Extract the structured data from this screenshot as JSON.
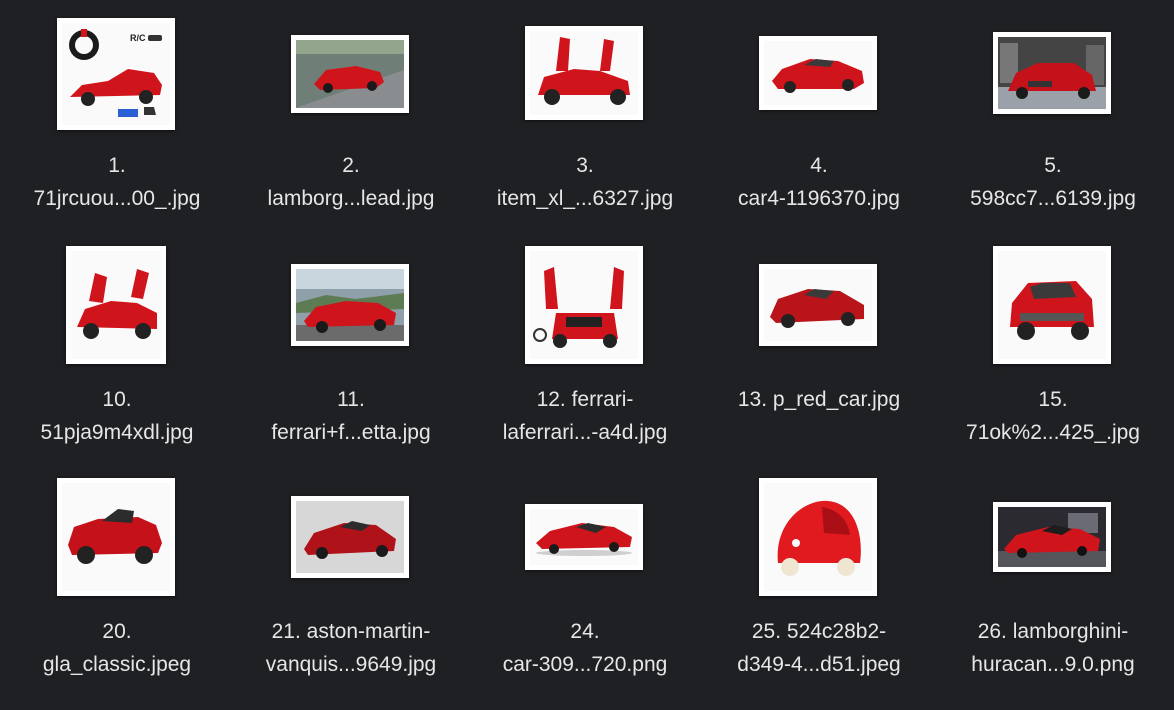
{
  "files": [
    {
      "line1": "1.",
      "line2": "71jrcuou...00_.jpg",
      "thumb": "rc-car-kit-thumbnail"
    },
    {
      "line1": "2.",
      "line2": "lamborg...lead.jpg",
      "thumb": "lamborghini-road-thumbnail"
    },
    {
      "line1": "3.",
      "line2": "item_xl_...6327.jpg",
      "thumb": "ride-on-car-doors-thumbnail"
    },
    {
      "line1": "4.",
      "line2": "car4-1196370.jpg",
      "thumb": "red-coupe-thumbnail"
    },
    {
      "line1": "5.",
      "line2": "598cc7...6139.jpg",
      "thumb": "maserati-showroom-thumbnail"
    },
    {
      "line1": "10.",
      "line2": "51pja9m4xdl.jpg",
      "thumb": "toy-supercar-doors-thumbnail"
    },
    {
      "line1": "11.",
      "line2": "ferrari+f...etta.jpg",
      "thumb": "ferrari-berlinetta-thumbnail"
    },
    {
      "line1": "12. ferrari-",
      "line2": "laferrari...-a4d.jpg",
      "thumb": "laferrari-toy-thumbnail"
    },
    {
      "line1": "13. p_red_car.jpg",
      "line2": "",
      "thumb": "mazda-rx8-thumbnail"
    },
    {
      "line1": "15.",
      "line2": "71ok%2...425_.jpg",
      "thumb": "ford-ecosport-thumbnail"
    },
    {
      "line1": "20.",
      "line2": "gla_classic.jpeg",
      "thumb": "gla-ride-on-thumbnail"
    },
    {
      "line1": "21. aston-martin-",
      "line2": "vanquis...9649.jpg",
      "thumb": "aston-martin-thumbnail"
    },
    {
      "line1": "24.",
      "line2": "car-309...720.png",
      "thumb": "red-sportscar-clipart-thumbnail"
    },
    {
      "line1": "25. 524c28b2-",
      "line2": "d349-4...d51.jpeg",
      "thumb": "toy-bubble-car-thumbnail"
    },
    {
      "line1": "26. lamborghini-",
      "line2": "huracan...9.0.png",
      "thumb": "lamborghini-huracan-thumbnail"
    }
  ],
  "colors": {
    "background": "#1f2023",
    "text": "#e6e6e6",
    "accent": "#d0141c"
  }
}
